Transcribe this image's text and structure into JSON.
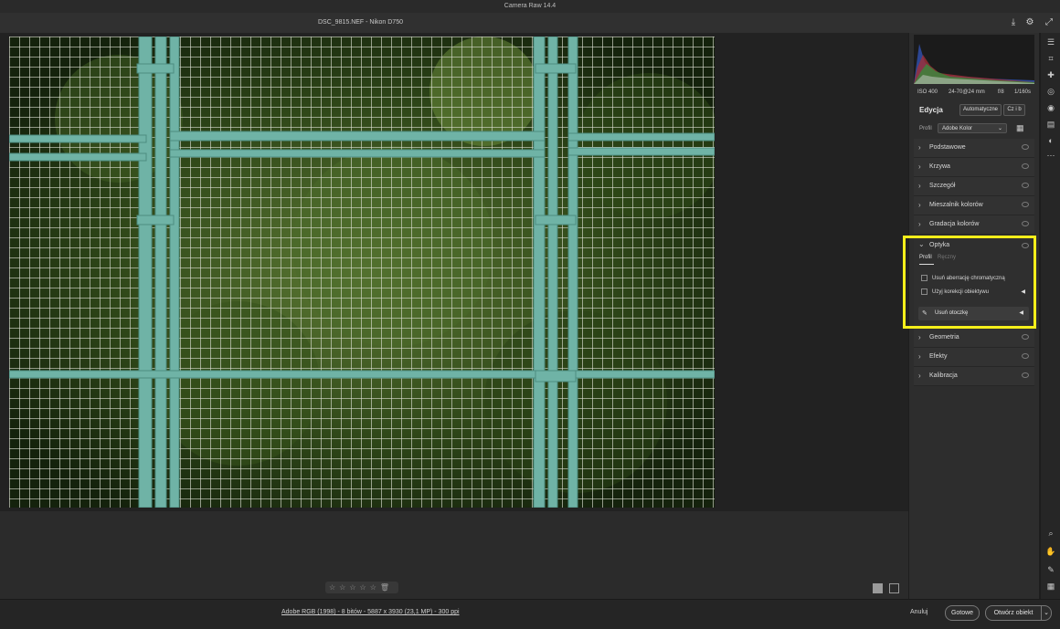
{
  "app_title": "Camera Raw 14.4",
  "file": {
    "name_label": "DSC_9815.NEF  -  Nikon D750"
  },
  "exif": {
    "iso": "ISO 400",
    "lens": "24-70@24 mm",
    "aperture": "f/8",
    "shutter": "1/160s"
  },
  "edit": {
    "title": "Edycja",
    "auto_label": "Automatyczne",
    "bw_label": "Cz i b",
    "profile_label": "Profil",
    "profile_value": "Adobe Kolor"
  },
  "sections_top": [
    "Podstawowe",
    "Krzywa",
    "Szczegół",
    "Mieszalnik kolorów",
    "Gradacja kolorów"
  ],
  "optics": {
    "title": "Optyka",
    "tab_profile": "Profil",
    "tab_manual": "Ręczny",
    "remove_ca": "Usuń aberrację chromatyczną",
    "use_lens_correction": "Użyj korekcji obiektywu",
    "defringe": "Usuń otoczkę"
  },
  "sections_bottom": [
    "Geometria",
    "Efekty",
    "Kalibracja"
  ],
  "footer": {
    "file_info": "Adobe RGB (1998) - 8 bitów - 5887 x 3930 (23,1 MP) - 300 ppi",
    "cancel": "Anuluj",
    "done": "Gotowe",
    "open": "Otwórz obiekt"
  },
  "rating": {
    "stars": [
      "☆",
      "☆",
      "☆",
      "☆",
      "☆"
    ]
  }
}
